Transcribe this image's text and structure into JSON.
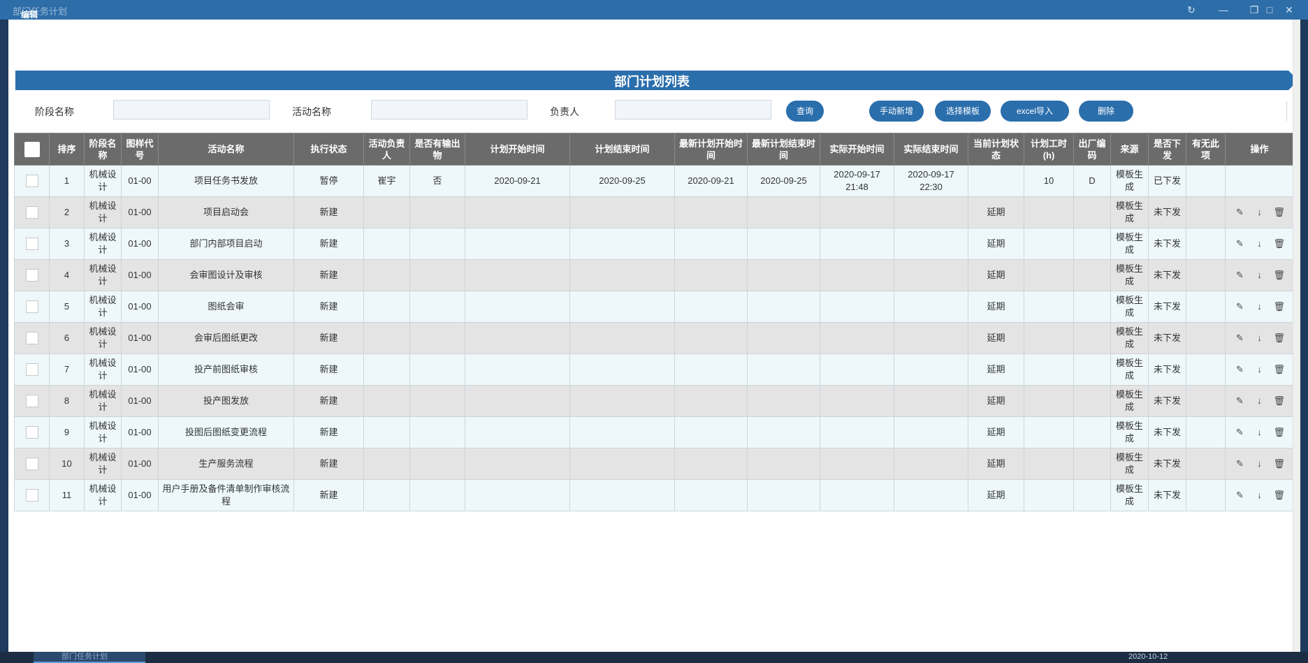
{
  "window": {
    "title": "部门任务计划",
    "edit_label": "编辑"
  },
  "banner": {
    "title": "部门计划列表"
  },
  "filters": {
    "stage_label": "阶段名称",
    "activity_label": "活动名称",
    "owner_label": "负责人",
    "stage_value": "",
    "activity_value": "",
    "owner_value": ""
  },
  "buttons": {
    "query": "查询",
    "manual_add": "手动新增",
    "choose_template": "选择模板",
    "excel_import": "excel导入",
    "delete": "删除"
  },
  "table": {
    "headers": [
      "",
      "排序",
      "阶段名称",
      "图样代号",
      "活动名称",
      "执行状态",
      "活动负责人",
      "是否有输出物",
      "计划开始时间",
      "计划结束时间",
      "最新计划开始时间",
      "最新计划结束时间",
      "实际开始时间",
      "实际结束时间",
      "当前计划状态",
      "计划工时(h)",
      "出厂编码",
      "来源",
      "是否下发",
      "有无此项",
      "操作"
    ],
    "rows": [
      {
        "seq": "1",
        "stage": "机械设计",
        "code": "01-00",
        "activity": "项目任务书发放",
        "status": "暂停",
        "owner": "崔宇",
        "output": "否",
        "plan_start": "2020-09-21",
        "plan_end": "2020-09-25",
        "new_start": "2020-09-21",
        "new_end": "2020-09-25",
        "act_start": "2020-09-17 21:48",
        "act_end": "2020-09-17 22:30",
        "cur_state": "",
        "hours": "10",
        "factory": "D",
        "source": "模板生成",
        "issued": "已下发",
        "has_item": "",
        "ops": false
      },
      {
        "seq": "2",
        "stage": "机械设计",
        "code": "01-00",
        "activity": "项目启动会",
        "status": "新建",
        "owner": "",
        "output": "",
        "plan_start": "",
        "plan_end": "",
        "new_start": "",
        "new_end": "",
        "act_start": "",
        "act_end": "",
        "cur_state": "延期",
        "hours": "",
        "factory": "",
        "source": "模板生成",
        "issued": "未下发",
        "has_item": "",
        "ops": true
      },
      {
        "seq": "3",
        "stage": "机械设计",
        "code": "01-00",
        "activity": "部门内部项目启动",
        "status": "新建",
        "owner": "",
        "output": "",
        "plan_start": "",
        "plan_end": "",
        "new_start": "",
        "new_end": "",
        "act_start": "",
        "act_end": "",
        "cur_state": "延期",
        "hours": "",
        "factory": "",
        "source": "模板生成",
        "issued": "未下发",
        "has_item": "",
        "ops": true
      },
      {
        "seq": "4",
        "stage": "机械设计",
        "code": "01-00",
        "activity": "会审图设计及审核",
        "status": "新建",
        "owner": "",
        "output": "",
        "plan_start": "",
        "plan_end": "",
        "new_start": "",
        "new_end": "",
        "act_start": "",
        "act_end": "",
        "cur_state": "延期",
        "hours": "",
        "factory": "",
        "source": "模板生成",
        "issued": "未下发",
        "has_item": "",
        "ops": true
      },
      {
        "seq": "5",
        "stage": "机械设计",
        "code": "01-00",
        "activity": "图纸会审",
        "status": "新建",
        "owner": "",
        "output": "",
        "plan_start": "",
        "plan_end": "",
        "new_start": "",
        "new_end": "",
        "act_start": "",
        "act_end": "",
        "cur_state": "延期",
        "hours": "",
        "factory": "",
        "source": "模板生成",
        "issued": "未下发",
        "has_item": "",
        "ops": true
      },
      {
        "seq": "6",
        "stage": "机械设计",
        "code": "01-00",
        "activity": "会审后图纸更改",
        "status": "新建",
        "owner": "",
        "output": "",
        "plan_start": "",
        "plan_end": "",
        "new_start": "",
        "new_end": "",
        "act_start": "",
        "act_end": "",
        "cur_state": "延期",
        "hours": "",
        "factory": "",
        "source": "模板生成",
        "issued": "未下发",
        "has_item": "",
        "ops": true
      },
      {
        "seq": "7",
        "stage": "机械设计",
        "code": "01-00",
        "activity": "投产前图纸审核",
        "status": "新建",
        "owner": "",
        "output": "",
        "plan_start": "",
        "plan_end": "",
        "new_start": "",
        "new_end": "",
        "act_start": "",
        "act_end": "",
        "cur_state": "延期",
        "hours": "",
        "factory": "",
        "source": "模板生成",
        "issued": "未下发",
        "has_item": "",
        "ops": true
      },
      {
        "seq": "8",
        "stage": "机械设计",
        "code": "01-00",
        "activity": "投产图发放",
        "status": "新建",
        "owner": "",
        "output": "",
        "plan_start": "",
        "plan_end": "",
        "new_start": "",
        "new_end": "",
        "act_start": "",
        "act_end": "",
        "cur_state": "延期",
        "hours": "",
        "factory": "",
        "source": "模板生成",
        "issued": "未下发",
        "has_item": "",
        "ops": true
      },
      {
        "seq": "9",
        "stage": "机械设计",
        "code": "01-00",
        "activity": "投图后图纸变更流程",
        "status": "新建",
        "owner": "",
        "output": "",
        "plan_start": "",
        "plan_end": "",
        "new_start": "",
        "new_end": "",
        "act_start": "",
        "act_end": "",
        "cur_state": "延期",
        "hours": "",
        "factory": "",
        "source": "模板生成",
        "issued": "未下发",
        "has_item": "",
        "ops": true
      },
      {
        "seq": "10",
        "stage": "机械设计",
        "code": "01-00",
        "activity": "生产服务流程",
        "status": "新建",
        "owner": "",
        "output": "",
        "plan_start": "",
        "plan_end": "",
        "new_start": "",
        "new_end": "",
        "act_start": "",
        "act_end": "",
        "cur_state": "延期",
        "hours": "",
        "factory": "",
        "source": "模板生成",
        "issued": "未下发",
        "has_item": "",
        "ops": true
      },
      {
        "seq": "11",
        "stage": "机械设计",
        "code": "01-00",
        "activity": "用户手册及备件清单制作审核流程",
        "status": "新建",
        "owner": "",
        "output": "",
        "plan_start": "",
        "plan_end": "",
        "new_start": "",
        "new_end": "",
        "act_start": "",
        "act_end": "",
        "cur_state": "延期",
        "hours": "",
        "factory": "",
        "source": "模板生成",
        "issued": "未下发",
        "has_item": "",
        "ops": true
      }
    ]
  },
  "taskbar": {
    "date": "2020-10-12"
  },
  "colors": {
    "primary": "#2a6eac",
    "header_bg": "#6b6b6b",
    "row_odd": "#eef8fb",
    "row_even": "#e4e4e4"
  },
  "icons": {
    "edit": "pencil-icon",
    "move_down": "arrow-down-icon",
    "delete": "trash-icon"
  }
}
